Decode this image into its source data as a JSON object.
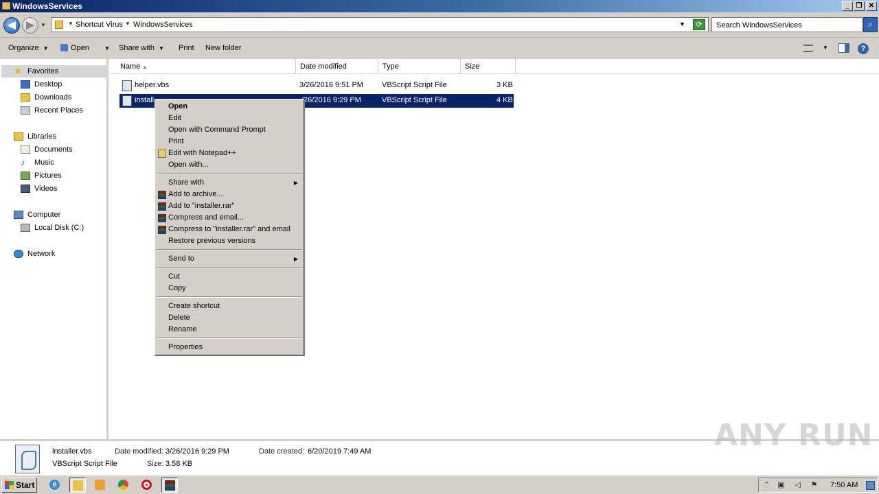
{
  "window": {
    "title": "WindowsServices",
    "buttons": {
      "minimize": "_",
      "maximize": "❐",
      "close": "✕"
    }
  },
  "address": {
    "crumbs": [
      "Shortcut Virus",
      "WindowsServices"
    ],
    "search_placeholder": "Search WindowsServices"
  },
  "toolbar": {
    "organize": "Organize",
    "open": "Open",
    "share_with": "Share with",
    "print": "Print",
    "new_folder": "New folder"
  },
  "nav": {
    "favorites": {
      "label": "Favorites",
      "items": [
        "Desktop",
        "Downloads",
        "Recent Places"
      ]
    },
    "libraries": {
      "label": "Libraries",
      "items": [
        "Documents",
        "Music",
        "Pictures",
        "Videos"
      ]
    },
    "computer": {
      "label": "Computer",
      "items": [
        "Local Disk (C:)"
      ]
    },
    "network": {
      "label": "Network"
    }
  },
  "columns": {
    "name": "Name",
    "date": "Date modified",
    "type": "Type",
    "size": "Size"
  },
  "files": [
    {
      "name": "helper.vbs",
      "date": "3/26/2016 9:51 PM",
      "type": "VBScript Script File",
      "size": "3 KB",
      "selected": false
    },
    {
      "name": "installer.vbs",
      "name_visible": "install",
      "date": "3/26/2016 9:29 PM",
      "date_visible": "/26/2016 9:29 PM",
      "type": "VBScript Script File",
      "size": "4 KB",
      "selected": true
    }
  ],
  "context_menu": {
    "open": "Open",
    "edit": "Edit",
    "open_cmd": "Open with Command Prompt",
    "print": "Print",
    "edit_npp": "Edit with Notepad++",
    "open_with": "Open with...",
    "share_with": "Share with",
    "add_archive": "Add to archive...",
    "add_rar": "Add to \"installer.rar\"",
    "compress_email": "Compress and email...",
    "compress_rar_email": "Compress to \"installer.rar\" and email",
    "restore": "Restore previous versions",
    "send_to": "Send to",
    "cut": "Cut",
    "copy": "Copy",
    "create_shortcut": "Create shortcut",
    "delete": "Delete",
    "rename": "Rename",
    "properties": "Properties"
  },
  "details": {
    "filename": "installer.vbs",
    "filetype": "VBScript Script File",
    "date_modified_label": "Date modified:",
    "date_modified": "3/26/2016 9:29 PM",
    "size_label": "Size:",
    "size": "3.58 KB",
    "date_created_label": "Date created:",
    "date_created": "6/20/2019 7:49 AM",
    "watermark": "ANY RUN"
  },
  "taskbar": {
    "start": "Start",
    "clock": "7:50 AM",
    "apps": [
      "internet-explorer",
      "windows-explorer",
      "media-player",
      "chrome",
      "opera",
      "winrar"
    ]
  }
}
